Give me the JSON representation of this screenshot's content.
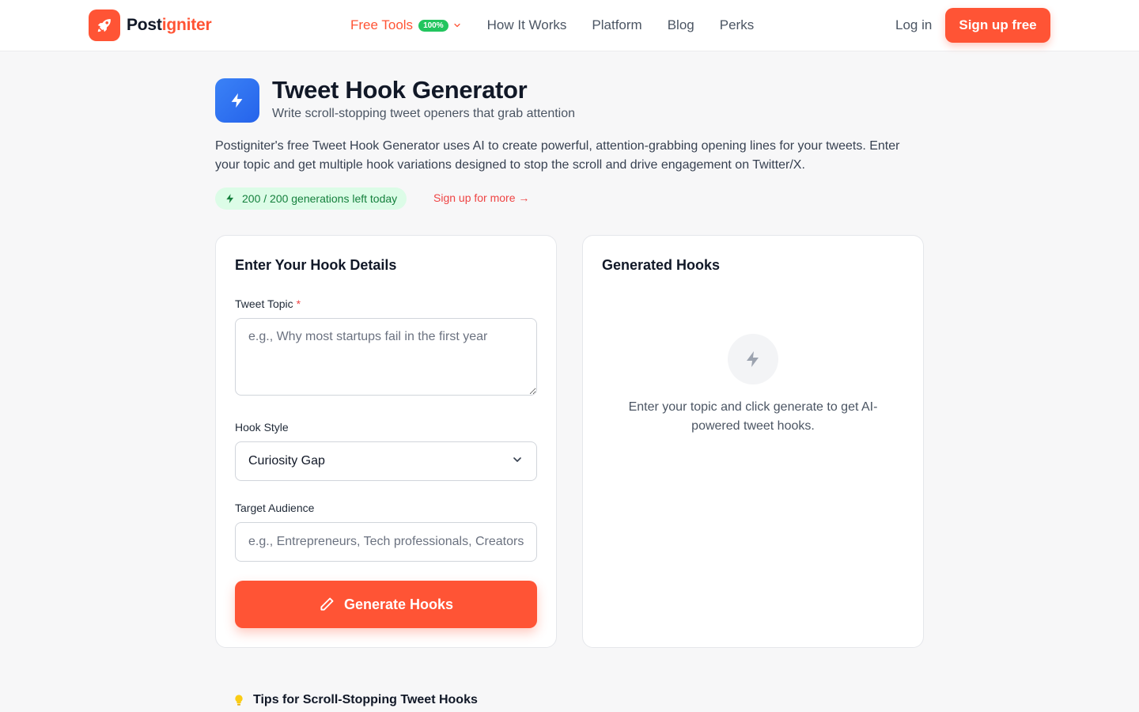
{
  "header": {
    "logo": {
      "prefix": "Post",
      "suffix": "igniter",
      "icon": "rocket-icon"
    },
    "nav": {
      "free_tools": "Free Tools",
      "free_tools_badge": "100%",
      "how_it_works": "How It Works",
      "platform": "Platform",
      "blog": "Blog",
      "perks": "Perks"
    },
    "login": "Log in",
    "signup": "Sign up free"
  },
  "hero": {
    "icon": "bolt-icon",
    "title": "Tweet Hook Generator",
    "subtitle": "Write scroll-stopping tweet openers that grab attention",
    "description": "Postigniter's free Tweet Hook Generator uses AI to create powerful, attention-grabbing opening lines for your tweets. Enter your topic and get multiple hook variations designed to stop the scroll and drive engagement on Twitter/X.",
    "generations_badge": "200 / 200 generations left today",
    "signup_more": "Sign up for more →"
  },
  "form": {
    "title": "Enter Your Hook Details",
    "topic_label": "Tweet Topic",
    "required_mark": "*",
    "topic_placeholder": "e.g., Why most startups fail in the first year",
    "style_label": "Hook Style",
    "style_value": "Curiosity Gap",
    "audience_label": "Target Audience",
    "audience_placeholder": "e.g., Entrepreneurs, Tech professionals, Creators",
    "generate_button": "Generate Hooks"
  },
  "results": {
    "title": "Generated Hooks",
    "empty_text": "Enter your topic and click generate to get AI-powered tweet hooks."
  },
  "tips": {
    "title": "Tips for Scroll-Stopping Tweet Hooks",
    "icon": "lightbulb-icon"
  },
  "colors": {
    "brand": "#ff5435",
    "success_bg": "#dcfce7",
    "success_text": "#15803d",
    "tool_blue": "#2563eb"
  }
}
